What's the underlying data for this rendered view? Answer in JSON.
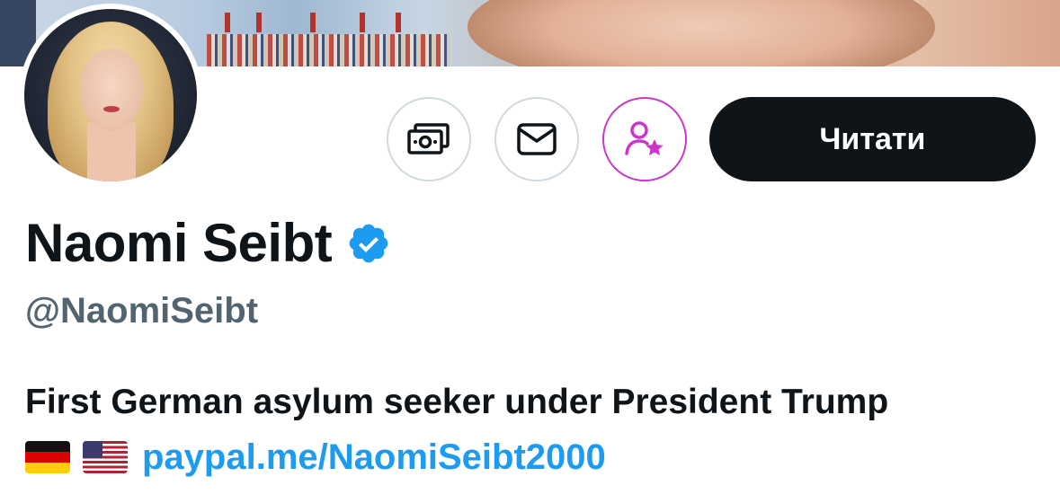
{
  "profile": {
    "display_name": "Naomi Seibt",
    "handle": "@NaomiSeibt",
    "verified": true,
    "bio_text": "First German asylum seeker under President Trump",
    "bio_link": "paypal.me/NaomiSeibt2000"
  },
  "actions": {
    "tip_icon": "money-icon",
    "message_icon": "envelope-icon",
    "subscribe_icon": "person-star-icon",
    "follow_label": "Читати"
  },
  "colors": {
    "follow_button_bg": "#0f1419",
    "verified_badge": "#1d9bf0",
    "link": "#1d9bf0",
    "handle": "#536471",
    "subscribe_accent": "#c936c9"
  }
}
